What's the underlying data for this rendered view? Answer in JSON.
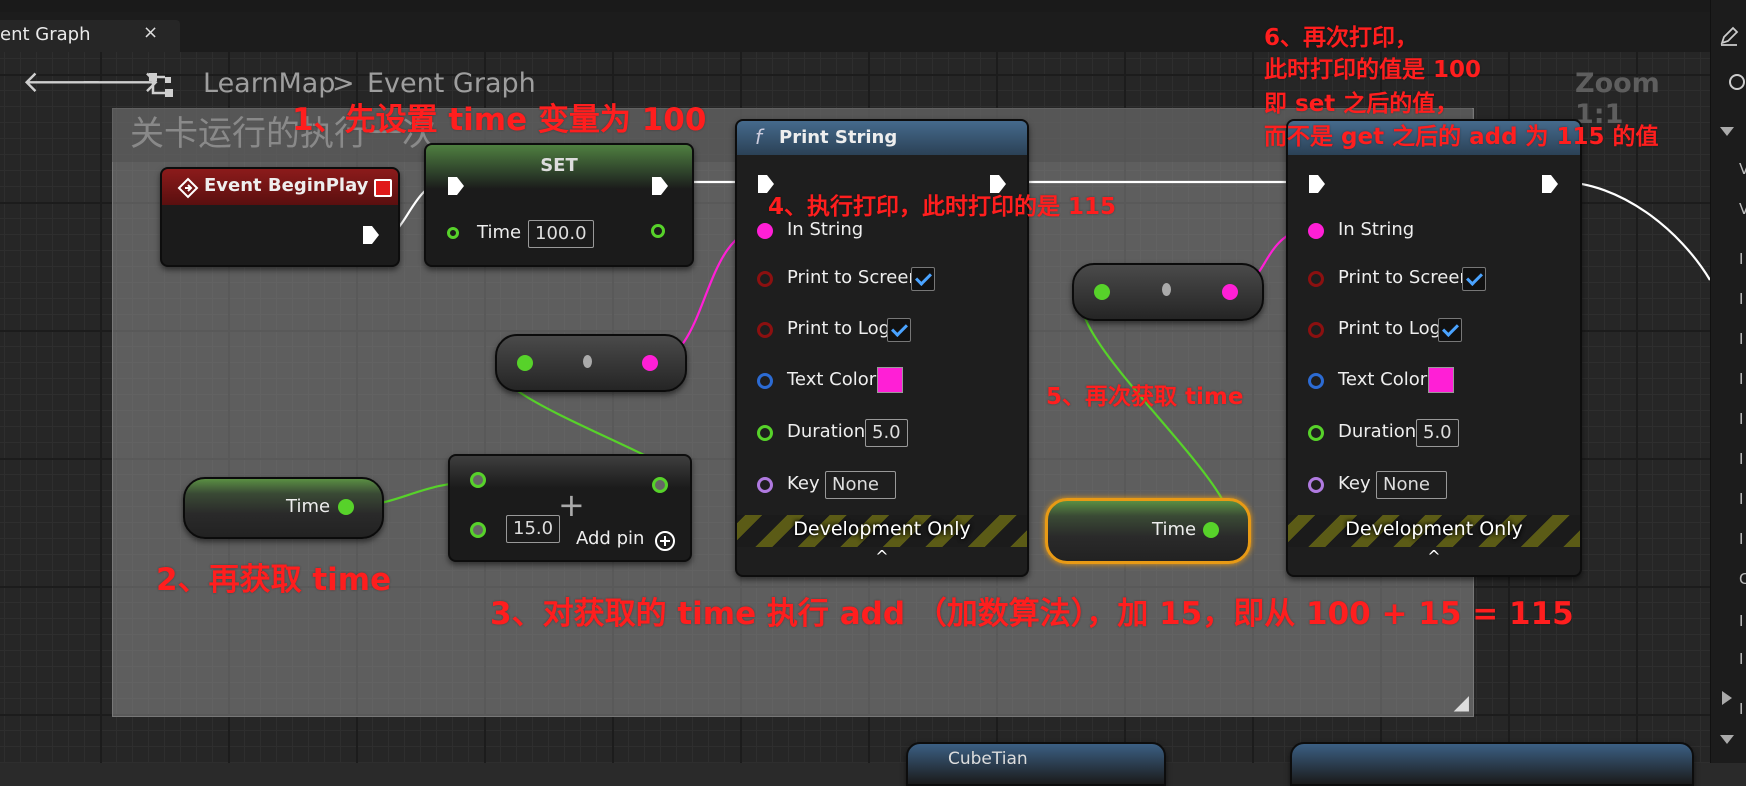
{
  "tab": {
    "label": "ent Graph",
    "close": "×"
  },
  "comment": {
    "title": "关卡运行的执行一次"
  },
  "breadcrumb": {
    "back": "🡐",
    "forward": "🡒",
    "map": "LearnMap",
    "sep": ">",
    "graph": "Event Graph",
    "zoom": "Zoom 1:1"
  },
  "nodes": {
    "begin_play": {
      "title": "Event BeginPlay"
    },
    "set": {
      "title": "SET",
      "pin_label": "Time",
      "value": "100.0"
    },
    "get_time_1": {
      "label": "Time"
    },
    "get_time_2": {
      "label": "Time"
    },
    "add": {
      "value": "15.0",
      "add_pin": "Add pin",
      "plus": "+"
    },
    "print1": {
      "title": "Print String",
      "func_icon": "f",
      "in_string": "In String",
      "print_screen": "Print to Screen",
      "print_log": "Print to Log",
      "text_color": "Text Color",
      "duration": "Duration",
      "duration_value": "5.0",
      "key": "Key",
      "key_value": "None",
      "dev_only": "Development Only",
      "caret": "^"
    },
    "print2": {
      "in_string": "In String",
      "print_screen": "Print to Screen",
      "print_log": "Print to Log",
      "text_color": "Text Color",
      "duration": "Duration",
      "duration_value": "5.0",
      "key": "Key",
      "key_value": "None",
      "dev_only": "Development Only",
      "caret": "^"
    },
    "bottom_node": {
      "title": "CubeTian"
    }
  },
  "annotations": {
    "a1": "1、先设置 time 变量为 100",
    "a2": "2、再获取 time",
    "a3": "3、对获取的 time 执行 add （加数算法），加 15，即从 100 + 15 = 115",
    "a4": "4、执行打印，此时打印的是 115",
    "a5": "5、再次获取 time",
    "a6_1": "6、再次打印，",
    "a6_2": "此时打印的值是 100",
    "a6_3": "即 set 之后的值，",
    "a6_4": "而不是 get 之后的 add 为 115 的值"
  },
  "right_panel": {
    "letters": [
      "V",
      "V",
      "I",
      "I",
      "I",
      "I",
      "I",
      "I",
      "I",
      "I",
      "C",
      "I",
      "I",
      "I",
      "A",
      "A"
    ]
  },
  "colors": {
    "exec": "#ffffff",
    "float_pin": "#57d22a",
    "string_pin": "#ff1fd6",
    "bool_pin": "#8c1010",
    "struct_pin": "#2c6bd3",
    "name_pin": "#b07ae0",
    "annotation": "#ff1e1e",
    "accent": "#ff1fd6"
  },
  "icons": {
    "event": "diamond-arrow-icon",
    "func": "function-icon",
    "graph": "blueprint-graph-icon"
  }
}
